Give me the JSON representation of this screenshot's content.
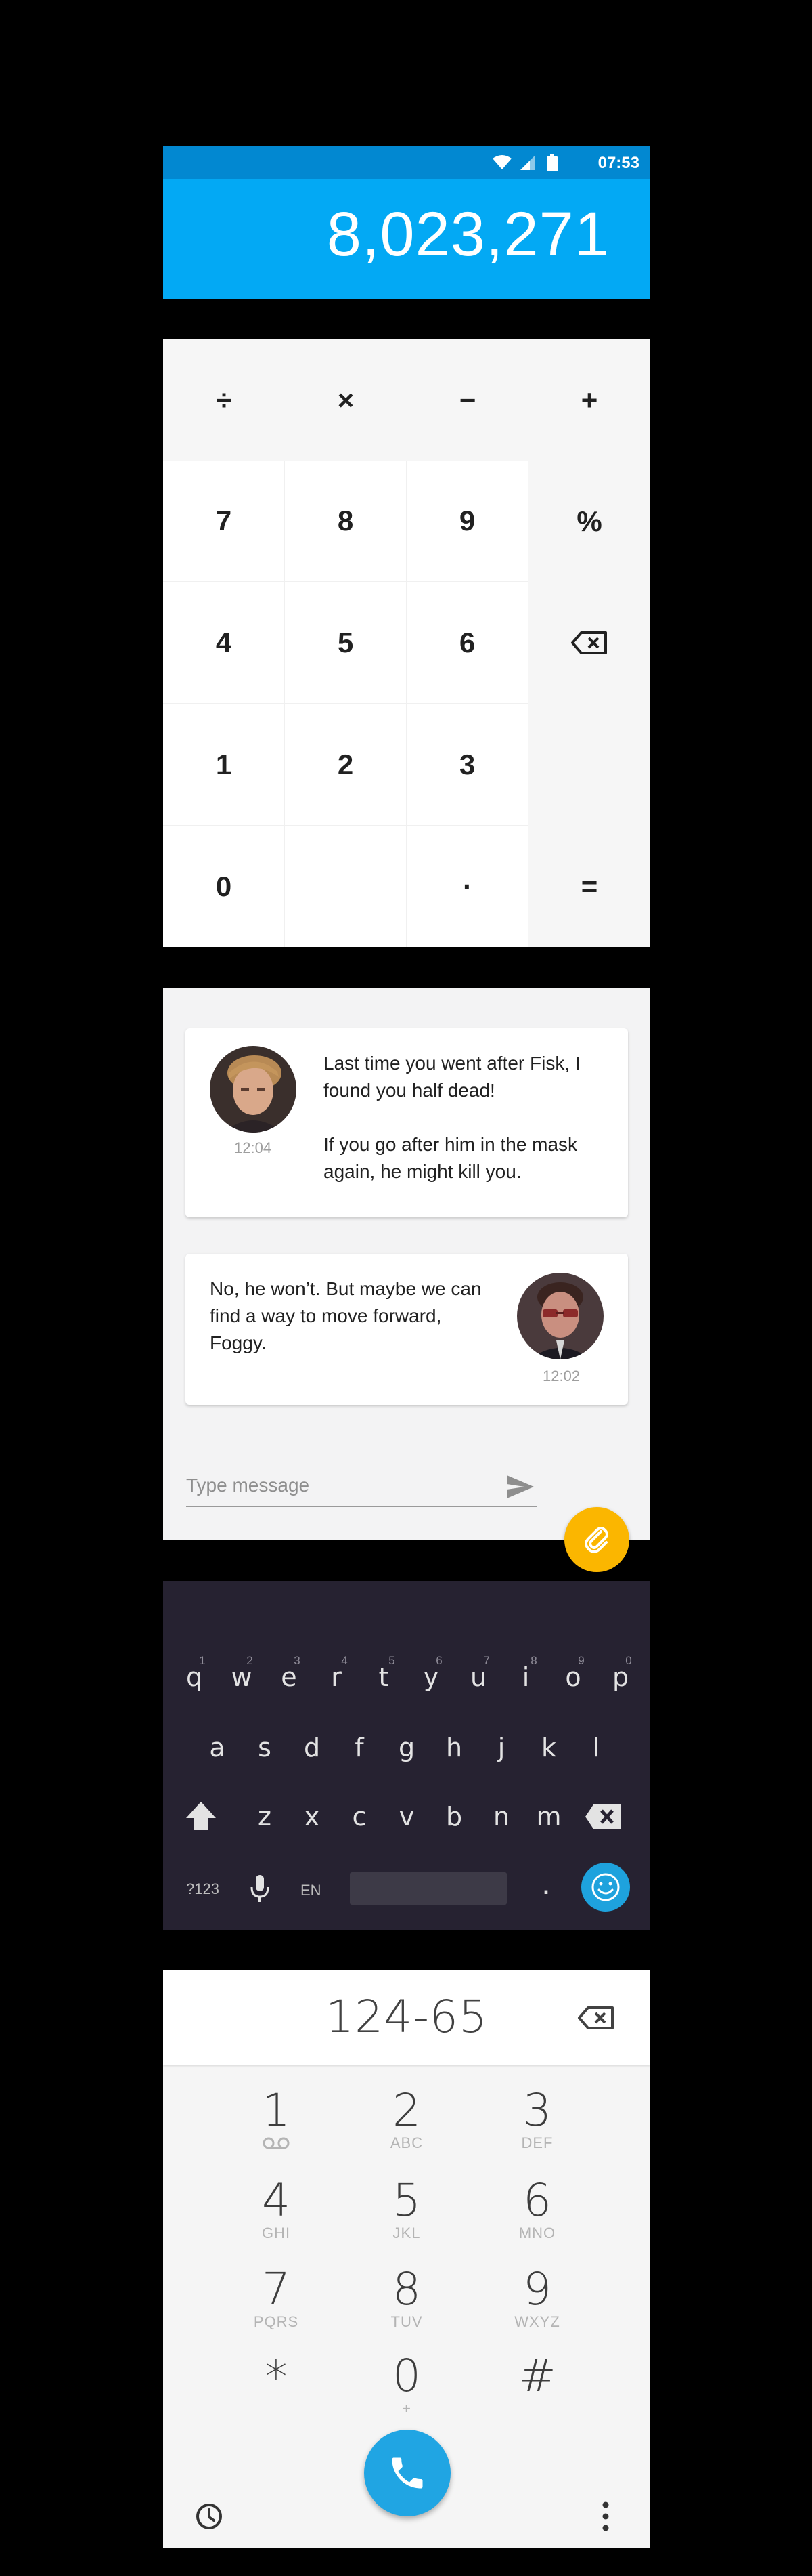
{
  "calculator": {
    "status_time": "07:53",
    "result": "8,023,271",
    "operators": [
      "÷",
      "×",
      "−",
      "+"
    ],
    "rows": [
      [
        "7",
        "8",
        "9",
        "%"
      ],
      [
        "4",
        "5",
        "6",
        ""
      ],
      [
        "1",
        "2",
        "3",
        ""
      ],
      [
        "0",
        "",
        "·",
        "="
      ]
    ]
  },
  "chat": {
    "messages": [
      {
        "text_lines": [
          "Last time you went after Fisk, I",
          "found you half dead!",
          "",
          "If you go after him in the mask",
          "again, he might kill you."
        ],
        "time": "12:04"
      },
      {
        "text_lines": [
          "No, he won’t. But maybe we can",
          "find a way to move forward,",
          "Foggy."
        ],
        "time": "12:02"
      }
    ],
    "input_placeholder": "Type message",
    "icons": {
      "send": "send-icon",
      "attach": "paperclip-icon"
    },
    "colors": {
      "fab": "#fbb600"
    }
  },
  "keyboard": {
    "row1": [
      "q",
      "w",
      "e",
      "r",
      "t",
      "y",
      "u",
      "i",
      "o",
      "p"
    ],
    "row1_hints": [
      "1",
      "2",
      "3",
      "4",
      "5",
      "6",
      "7",
      "8",
      "9",
      "0"
    ],
    "row2": [
      "a",
      "s",
      "d",
      "f",
      "g",
      "h",
      "j",
      "k",
      "l"
    ],
    "row3": [
      "z",
      "x",
      "c",
      "v",
      "b",
      "n",
      "m"
    ],
    "symbols_label": "?123",
    "language_label": "EN",
    "period": "."
  },
  "dialer": {
    "number": "124-65",
    "keys": [
      {
        "digit": "1",
        "letters": ""
      },
      {
        "digit": "2",
        "letters": "ABC"
      },
      {
        "digit": "3",
        "letters": "DEF"
      },
      {
        "digit": "4",
        "letters": "GHI"
      },
      {
        "digit": "5",
        "letters": "JKL"
      },
      {
        "digit": "6",
        "letters": "MNO"
      },
      {
        "digit": "7",
        "letters": "PQRS"
      },
      {
        "digit": "8",
        "letters": "TUV"
      },
      {
        "digit": "9",
        "letters": "WXYZ"
      },
      {
        "digit": "*",
        "letters": ""
      },
      {
        "digit": "0",
        "letters": "+"
      },
      {
        "digit": "#",
        "letters": ""
      }
    ],
    "colors": {
      "call": "#20a5e3"
    }
  }
}
